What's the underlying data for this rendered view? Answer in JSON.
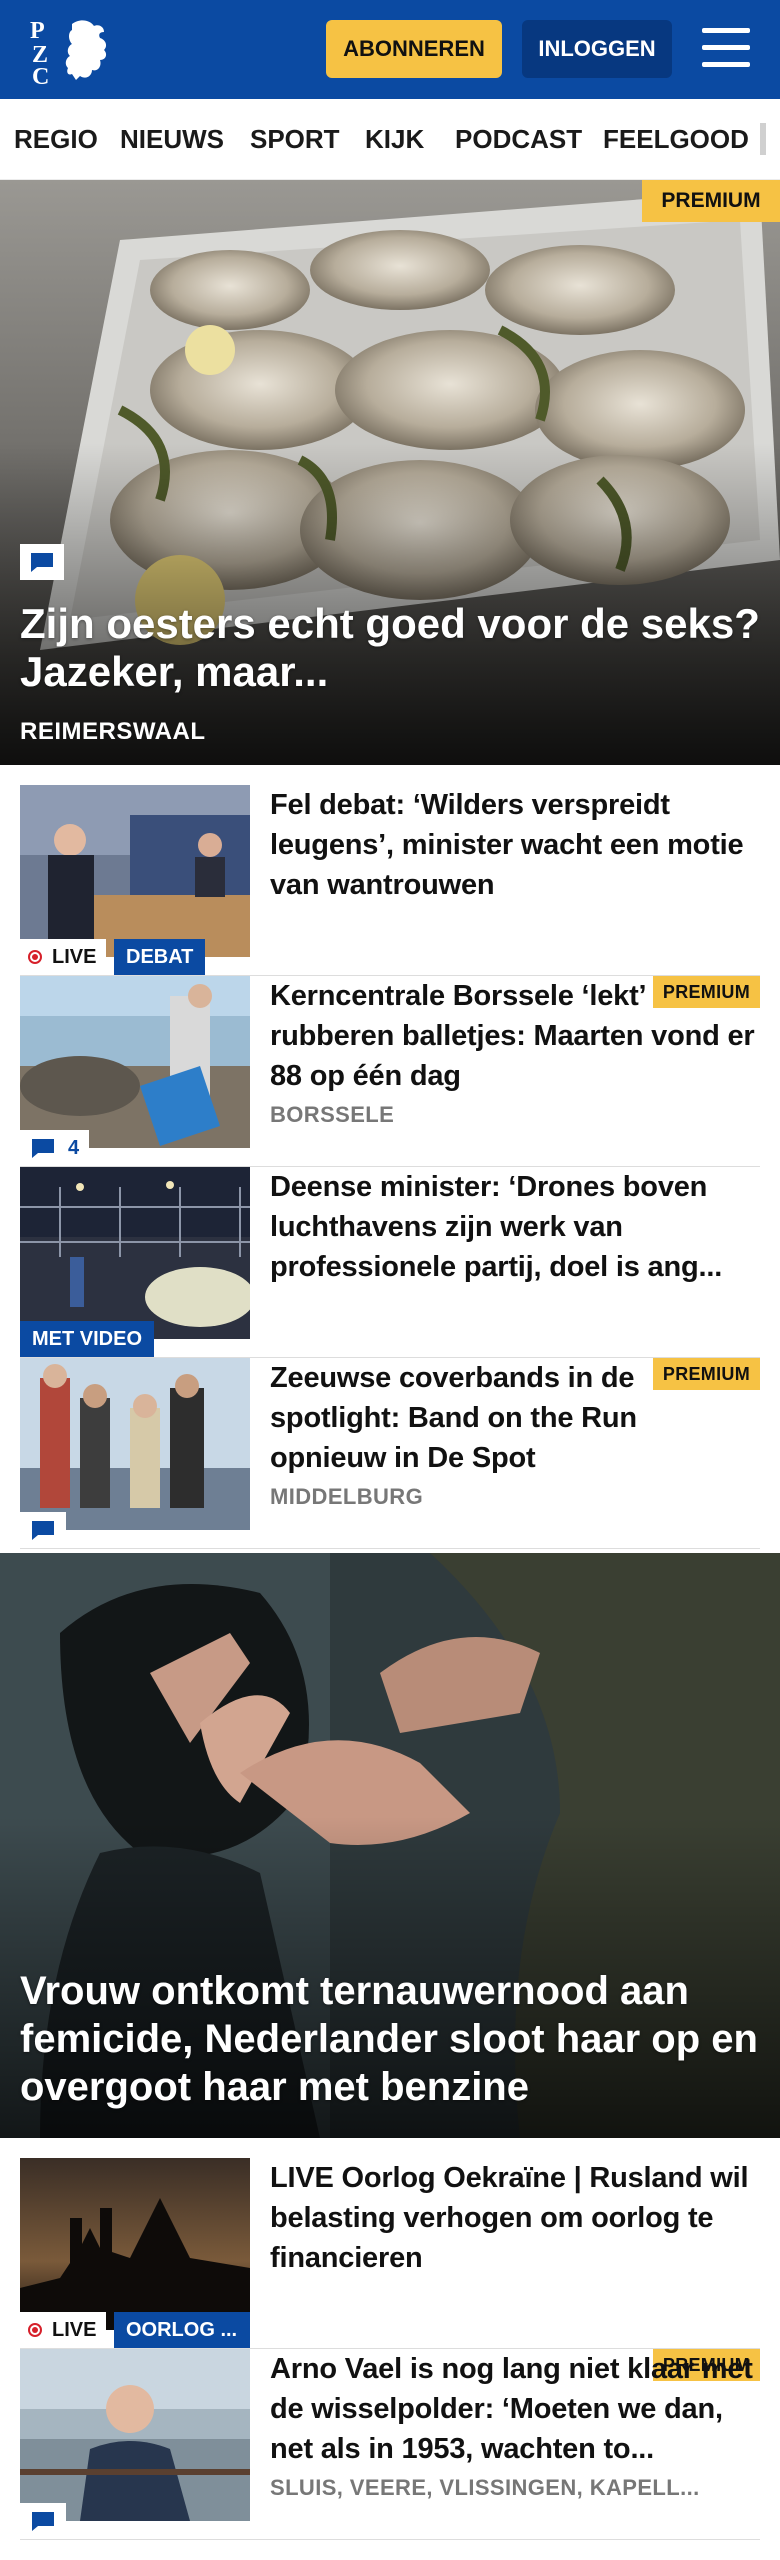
{
  "header": {
    "logo_letters": "PZC",
    "subscribe_label": "ABONNEREN",
    "login_label": "INLOGGEN",
    "menu_icon": "hamburger-menu-icon",
    "brand_color": "#0b4aa2",
    "accent_color": "#f6c244"
  },
  "nav": {
    "items": [
      "REGIO",
      "NIEUWS",
      "SPORT",
      "KIJK",
      "PODCAST",
      "FEELGOOD"
    ]
  },
  "hero": {
    "premium_label": "PREMIUM",
    "title": "Zijn oesters echt goed voor de seks? Jazeker, maar...",
    "location": "REIMERSWAAL",
    "has_comments_icon": "comment-icon"
  },
  "articles1": [
    {
      "title": "Fel debat: ‘Wilders verspreidt leugens’, minister wacht een motie van wantrouwen",
      "live_label": "LIVE",
      "tag_label": "DEBAT"
    },
    {
      "title": "Kerncentrale Borssele ‘lekt’ rubberen balletjes: Maarten vond er 88 op één dag",
      "premium_label": "PREMIUM",
      "comment_count": "4",
      "location": "BORSSELE"
    },
    {
      "title": "Deense minister: ‘Drones boven luchthavens zijn werk van professionele partij, doel is ang...",
      "tag_label": "MET VIDEO"
    },
    {
      "title": "Zeeuwse coverbands in de spotlight: Band on the Run opnieuw in De Spot",
      "premium_label": "PREMIUM",
      "location": "MIDDELBURG"
    }
  ],
  "hero2": {
    "title": "Vrouw ontkomt ternauwernood aan femicide, Nederlander sloot haar op en overgoot haar met benzine"
  },
  "articles2": [
    {
      "title": "LIVE Oorlog Oekraïne | Rusland wil belasting verhogen om oorlog te financieren",
      "live_label": "LIVE",
      "tag_label": "OORLOG ..."
    },
    {
      "title": "Arno Vael is nog lang niet klaar met de wisselpolder: ‘Moeten we dan, net als in 1953, wachten to...",
      "premium_label": "PREMIUM",
      "location": "SLUIS, VEERE, VLISSINGEN, KAPELL..."
    }
  ]
}
